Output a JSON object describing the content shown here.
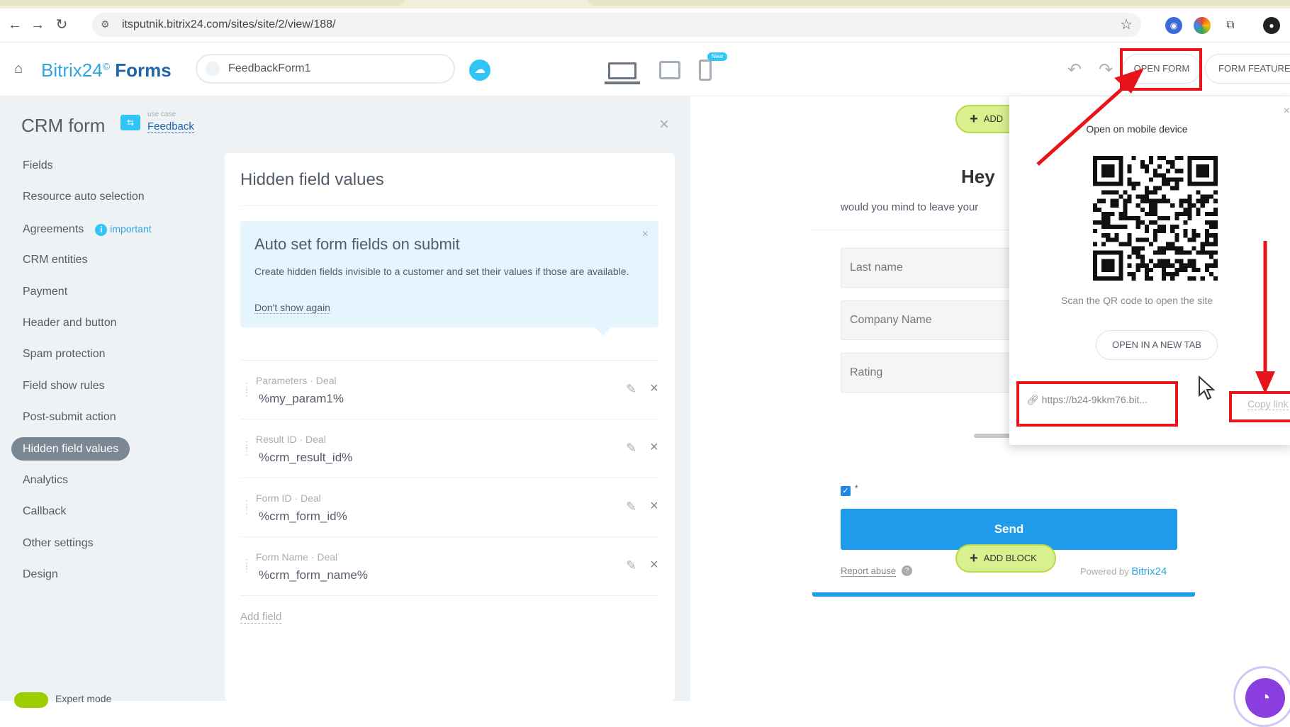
{
  "browser": {
    "url": "itsputnik.bitrix24.com/sites/site/2/view/188/",
    "back_icon": "←",
    "forward_icon": "→",
    "reload_icon": "↻"
  },
  "app": {
    "brand_prefix": "Bitrix24",
    "brand_suffix": "Forms",
    "form_name": "FeedbackForm1",
    "new_badge": "New",
    "open_form_label": "OPEN FORM",
    "form_features_label": "FORM FEATURES"
  },
  "sidebar": {
    "title": "CRM form",
    "use_case_small": "use case",
    "use_case_link": "Feedback",
    "important_label": "important",
    "items": [
      {
        "label": "Fields"
      },
      {
        "label": "Resource auto selection"
      },
      {
        "label": "Agreements"
      },
      {
        "label": "CRM entities"
      },
      {
        "label": "Payment"
      },
      {
        "label": "Header and button"
      },
      {
        "label": "Spam protection"
      },
      {
        "label": "Field show rules"
      },
      {
        "label": "Post-submit action"
      },
      {
        "label": "Hidden field values"
      },
      {
        "label": "Analytics"
      },
      {
        "label": "Callback"
      },
      {
        "label": "Other settings"
      },
      {
        "label": "Design"
      }
    ],
    "active_index": 9,
    "expert_mode": "Expert mode"
  },
  "card": {
    "title": "Hidden field values",
    "info_title": "Auto set form fields on submit",
    "info_text": "Create hidden fields invisible to a customer and set their values if those are available.",
    "info_dismiss": "Don't show again",
    "fields": [
      {
        "label": "Parameters · Deal",
        "value": "%my_param1%"
      },
      {
        "label": "Result ID · Deal",
        "value": "%crm_result_id%"
      },
      {
        "label": "Form ID · Deal",
        "value": "%crm_form_id%"
      },
      {
        "label": "Form Name · Deal",
        "value": "%crm_form_name%"
      }
    ],
    "add_field": "Add field"
  },
  "preview": {
    "add_block_top": "ADD",
    "heading": "Hey",
    "subheading": "would you mind to leave your",
    "inputs": [
      "Last name",
      "Company Name",
      "Rating"
    ],
    "required_mark": "*",
    "send_label": "Send",
    "report_abuse": "Report abuse",
    "powered_by": "Powered by",
    "powered_brand": "Bitrix24",
    "add_block_bottom": "ADD BLOCK"
  },
  "popup": {
    "title": "Open on mobile device",
    "scan_text": "Scan the QR code to open the site",
    "open_new_tab": "OPEN IN A NEW TAB",
    "link": "https://b24-9kkm76.bit...",
    "copy_link": "Copy link"
  },
  "colors": {
    "accent": "#2fc6f6",
    "annotation_red": "#e8141b",
    "add_block_green": "#d8f08e",
    "send_blue": "#1e9bea"
  }
}
